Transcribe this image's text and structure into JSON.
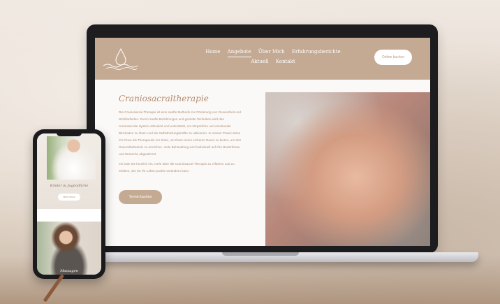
{
  "site": {
    "nav": {
      "items": [
        {
          "label": "Home"
        },
        {
          "label": "Angebote"
        },
        {
          "label": "Über Mich"
        },
        {
          "label": "Erfahrungsberichte"
        },
        {
          "label": "Aktuell"
        },
        {
          "label": "Kontakt"
        }
      ],
      "active": "Angebote"
    },
    "header_button": "Online buchen",
    "title": "Craniosacraltherapie",
    "paragraphs": [
      "Die Craniosacral-Therapie ist eine sanfte Methode zur Förderung von Gesundheit und Wohlbefinden. Durch sanfte Berührungen und gezielte Techniken wird das craniosacrale System stimuliert und unterstützt, um körperliche und emotionale Blockaden zu lösen und die Selbstheilungskräfte zu aktivieren. In meiner Praxis stehe ich Ihnen als Therapeutin zur Seite, um Ihnen einen sicheren Raum zu bieten, um Ihre Gesundheitsziele zu erreichen. Jede Behandlung wird individuell auf Ihre Bedürfnisse und Wünsche abgestimmt.",
      "Ich lade Sie herzlich ein, mehr über die Craniosacral-Therapie zu erfahren und zu erleben, wie sie Ihr Leben positiv verändern kann."
    ],
    "cta_button": "Termin buchen"
  },
  "phone": {
    "card1_title": "Kinder & Jugendliche",
    "card1_button": "Mehr lesen",
    "card2_title": "Massagen"
  },
  "colors": {
    "accent": "#c4a993",
    "title": "#b58c6f",
    "text": "#b08f77"
  }
}
